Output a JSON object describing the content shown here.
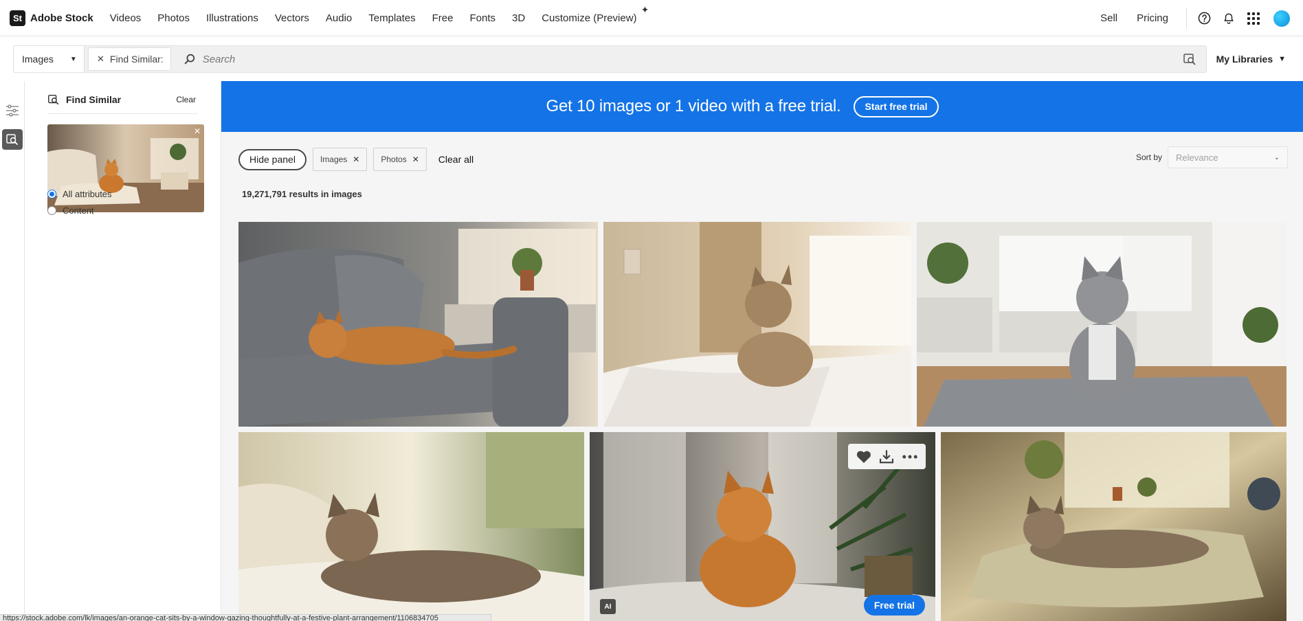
{
  "topnav": {
    "logo_mark": "St",
    "brand": "Adobe Stock",
    "links": [
      "Videos",
      "Photos",
      "Illustrations",
      "Vectors",
      "Audio",
      "Templates",
      "Free",
      "Fonts",
      "3D",
      "Customize (Preview)"
    ],
    "sell": "Sell",
    "pricing": "Pricing",
    "icons": [
      "help-icon",
      "bell-icon",
      "apps-grid-icon"
    ]
  },
  "search": {
    "type_value": "Images",
    "find_similar_chip": "Find Similar:",
    "placeholder": "Search",
    "my_libraries": "My Libraries"
  },
  "panel": {
    "title": "Find Similar",
    "clear": "Clear",
    "options": [
      {
        "label": "All attributes",
        "checked": true
      },
      {
        "label": "Content",
        "checked": false
      }
    ]
  },
  "banner": {
    "text": "Get 10 images or 1 video with a free trial.",
    "cta": "Start free trial"
  },
  "filters": {
    "hide_panel": "Hide panel",
    "chips": [
      "Images",
      "Photos"
    ],
    "clear_all": "Clear all",
    "sort_label": "Sort by",
    "sort_value": "Relevance"
  },
  "results": {
    "text": "19,271,791 results in images"
  },
  "hover_card": {
    "ai_badge": "AI",
    "cta": "Free trial"
  },
  "statusbar": {
    "url": "https://stock.adobe.com/lk/images/an-orange-cat-sits-by-a-window-gazing-thoughtfully-at-a-festive-plant-arrangement/1106834705"
  },
  "colors": {
    "accent_blue": "#1473e6",
    "banner_bg": "#1473e6",
    "main_bg": "#f5f5f5"
  }
}
